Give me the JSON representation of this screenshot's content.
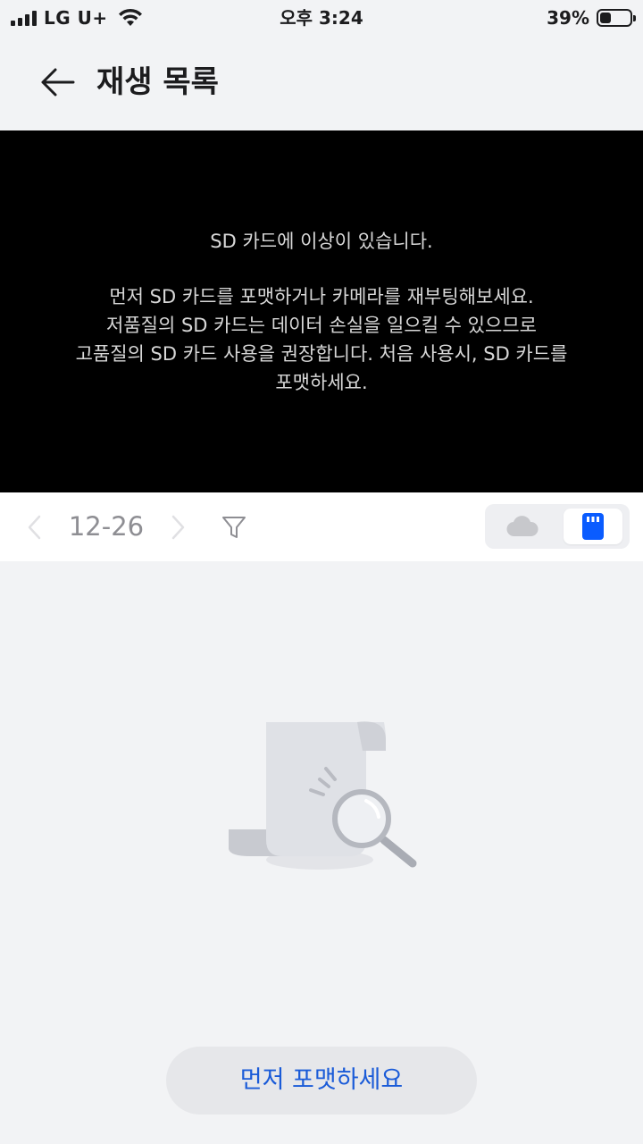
{
  "status_bar": {
    "carrier": "LG U+",
    "time": "오후 3:24",
    "battery_percent": "39%",
    "battery_level": 0.39
  },
  "header": {
    "title": "재생 목록"
  },
  "video": {
    "error_title": "SD 카드에 이상이 있습니다.",
    "error_lines": [
      "먼저 SD 카드를 포맷하거나 카메라를 재부팅해보세요.",
      "저품질의 SD 카드는 데이터 손실을 일으킬 수 있으므로",
      "고품질의 SD 카드 사용을 권장합니다. 처음 사용시, SD 카드를",
      "포맷하세요."
    ]
  },
  "toolbar": {
    "date": "12-26",
    "selected_source": "sd-card"
  },
  "actions": {
    "format_button_label": "먼저 포맷하세요"
  },
  "colors": {
    "accent": "#1a5bd8",
    "sd_icon": "#0a5cff",
    "background": "#f2f3f5"
  }
}
